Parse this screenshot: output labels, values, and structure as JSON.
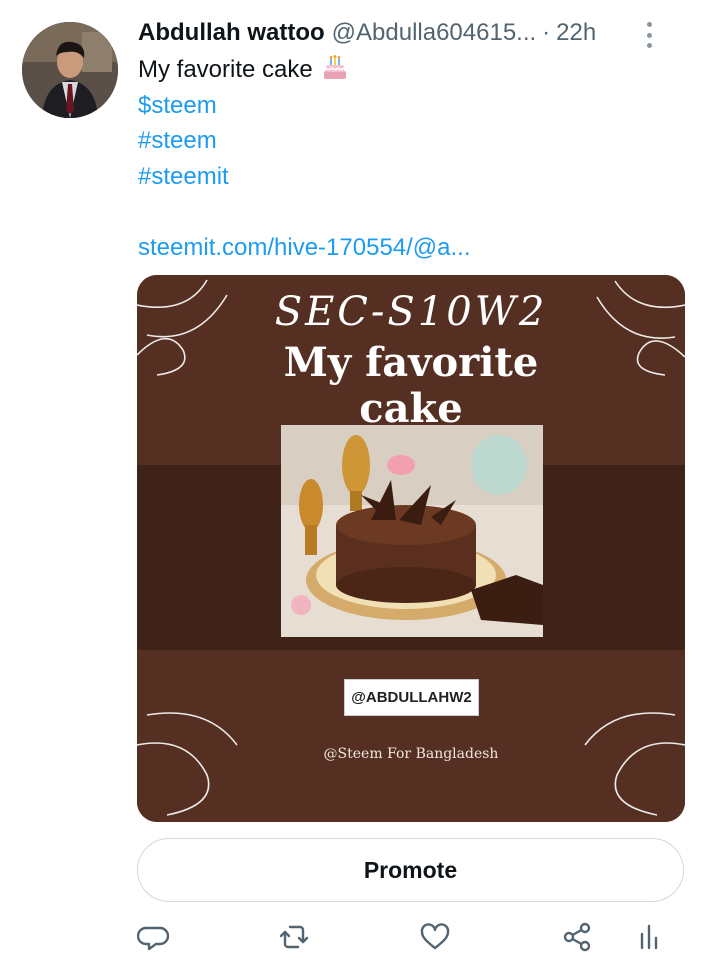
{
  "tweet": {
    "author_name": "Abdullah wattoo",
    "author_handle": "@Abdulla604615...",
    "separator": "·",
    "time": "22h",
    "text_line": "My favorite cake",
    "text_emoji": "birthday-cake-emoji",
    "cashtag": "$steem",
    "hashtags": [
      "#steem",
      "#steemit"
    ],
    "link": "steemit.com/hive-170554/@a..."
  },
  "media": {
    "line1": "SEC-S10W2",
    "line2": "My favorite",
    "line3": "cake",
    "tag": "@ABDULLAHW2",
    "credit": "@Steem For Bangladesh",
    "colors": {
      "background": "#552f22",
      "band": "#3f2218"
    }
  },
  "promote_label": "Promote",
  "actions": {
    "icons": [
      "reply-icon",
      "retweet-icon",
      "like-icon",
      "share-icon",
      "analytics-icon"
    ]
  },
  "colors": {
    "link": "#1d9bf0",
    "text": "#0f1419",
    "muted": "#536471"
  }
}
